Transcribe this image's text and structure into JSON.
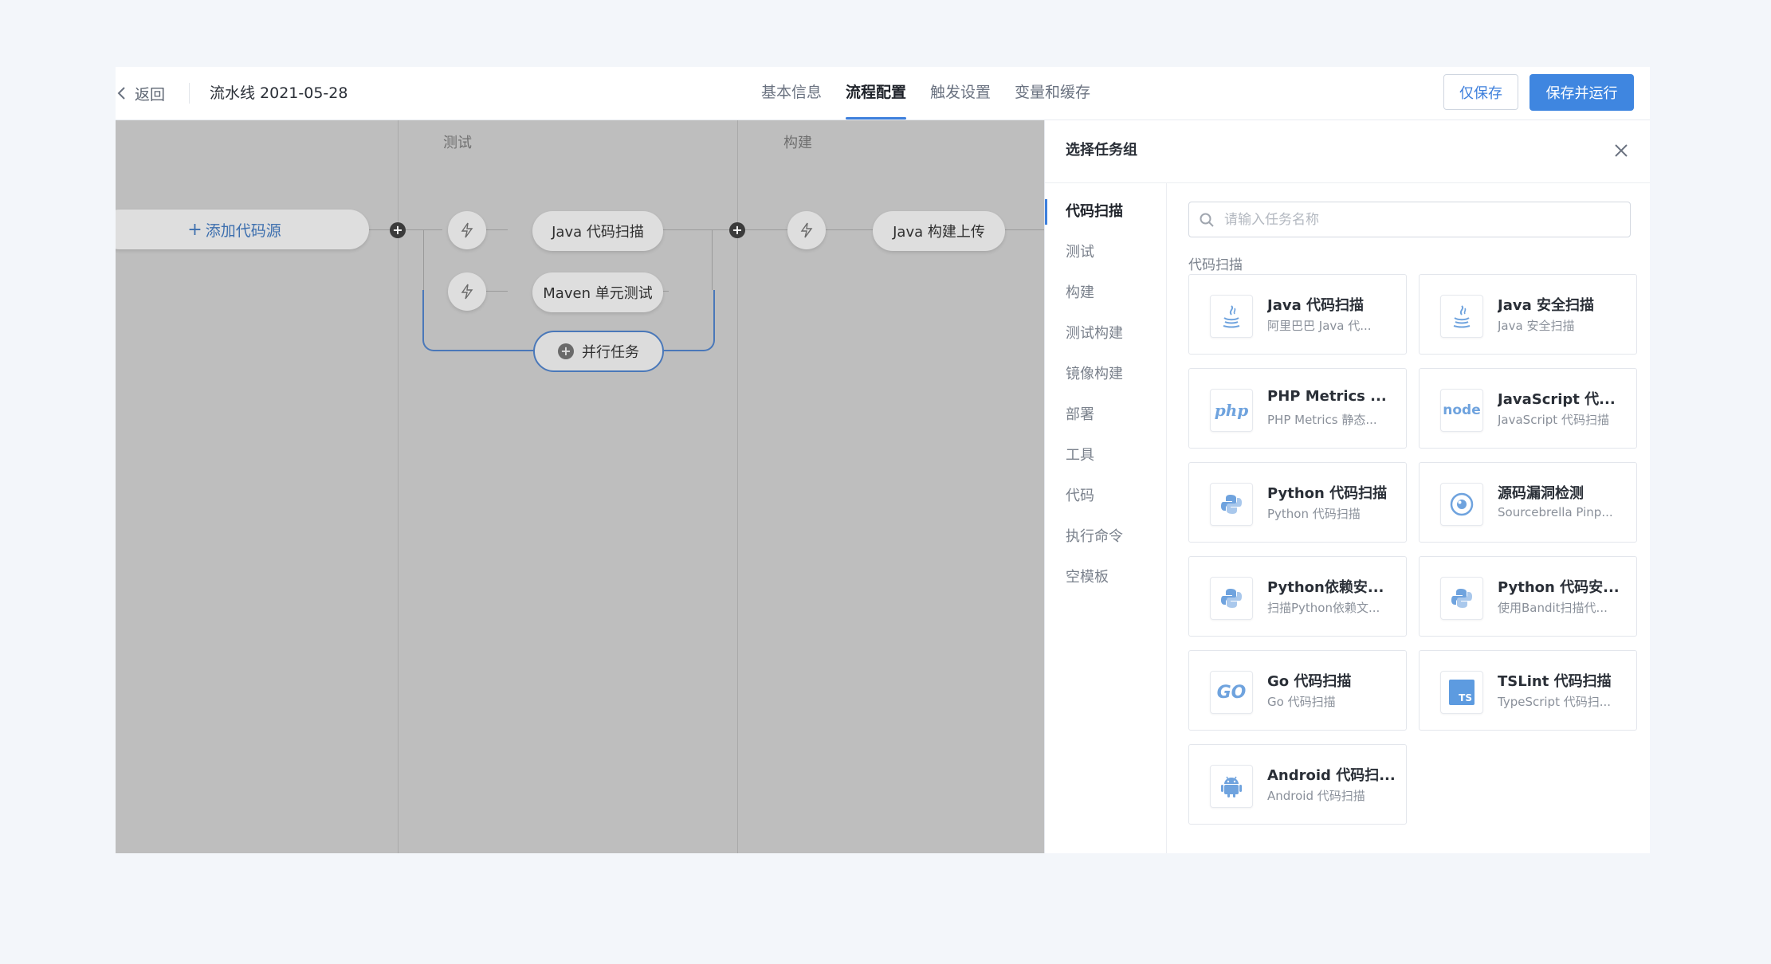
{
  "header": {
    "back_label": "返回",
    "pipeline_title": "流水线 2021-05-28",
    "tabs": [
      {
        "label": "基本信息"
      },
      {
        "label": "流程配置"
      },
      {
        "label": "触发设置"
      },
      {
        "label": "变量和缓存"
      }
    ],
    "active_tab": "流程配置",
    "save_only_label": "仅保存",
    "save_run_label": "保存并运行"
  },
  "canvas": {
    "stages": [
      {
        "title": "测试"
      },
      {
        "title": "构建"
      }
    ],
    "add_source_label": "添加代码源",
    "tasks": {
      "java_scan": "Java 代码扫描",
      "maven_test": "Maven 单元测试",
      "java_build": "Java 构建上传"
    },
    "parallel_label": "并行任务"
  },
  "drawer": {
    "title": "选择任务组",
    "categories": [
      {
        "label": "代码扫描"
      },
      {
        "label": "测试"
      },
      {
        "label": "构建"
      },
      {
        "label": "测试构建"
      },
      {
        "label": "镜像构建"
      },
      {
        "label": "部署"
      },
      {
        "label": "工具"
      },
      {
        "label": "代码"
      },
      {
        "label": "执行命令"
      },
      {
        "label": "空模板"
      }
    ],
    "active_category": "代码扫描",
    "search_placeholder": "请输入任务名称",
    "section_label": "代码扫描",
    "cards": [
      {
        "name": "Java 代码扫描",
        "desc": "阿里巴巴 Java 代...",
        "icon": "java-icon"
      },
      {
        "name": "Java 安全扫描",
        "desc": "Java 安全扫描",
        "icon": "java-icon"
      },
      {
        "name": "PHP Metrics ...",
        "desc": "PHP Metrics 静态...",
        "icon": "php-icon",
        "icon_text": "php"
      },
      {
        "name": "JavaScript 代...",
        "desc": "JavaScript 代码扫描",
        "icon": "node-icon",
        "icon_text": "node"
      },
      {
        "name": "Python 代码扫描",
        "desc": "Python 代码扫描",
        "icon": "python-icon"
      },
      {
        "name": "源码漏洞检测",
        "desc": "Sourcebrella Pinp...",
        "icon": "eye-icon"
      },
      {
        "name": "Python依赖安...",
        "desc": "扫描Python依赖文...",
        "icon": "python-icon"
      },
      {
        "name": "Python 代码安...",
        "desc": "使用Bandit扫描代...",
        "icon": "python-icon"
      },
      {
        "name": "Go 代码扫描",
        "desc": "Go 代码扫描",
        "icon": "go-icon",
        "icon_text": "GO"
      },
      {
        "name": "TSLint 代码扫描",
        "desc": "TypeScript 代码扫...",
        "icon": "typescript-icon",
        "icon_text": "TS"
      },
      {
        "name": "Android 代码扫...",
        "desc": "Android 代码扫描",
        "icon": "android-icon"
      }
    ]
  },
  "colors": {
    "accent": "#3f86e0",
    "canvas_bg": "#bebebe",
    "parallel_border": "#4a78b9",
    "page_bg": "#f3f6fa"
  }
}
